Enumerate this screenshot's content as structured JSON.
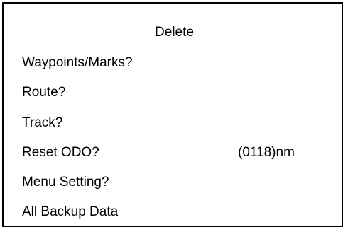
{
  "menu": {
    "title": "Delete",
    "items": [
      {
        "label": "Waypoints/Marks?"
      },
      {
        "label": "Route?"
      },
      {
        "label": "Track?"
      },
      {
        "label": "Reset ODO?",
        "value": "(0118)nm"
      },
      {
        "label": "Menu Setting?"
      },
      {
        "label": "All Backup Data"
      }
    ]
  }
}
